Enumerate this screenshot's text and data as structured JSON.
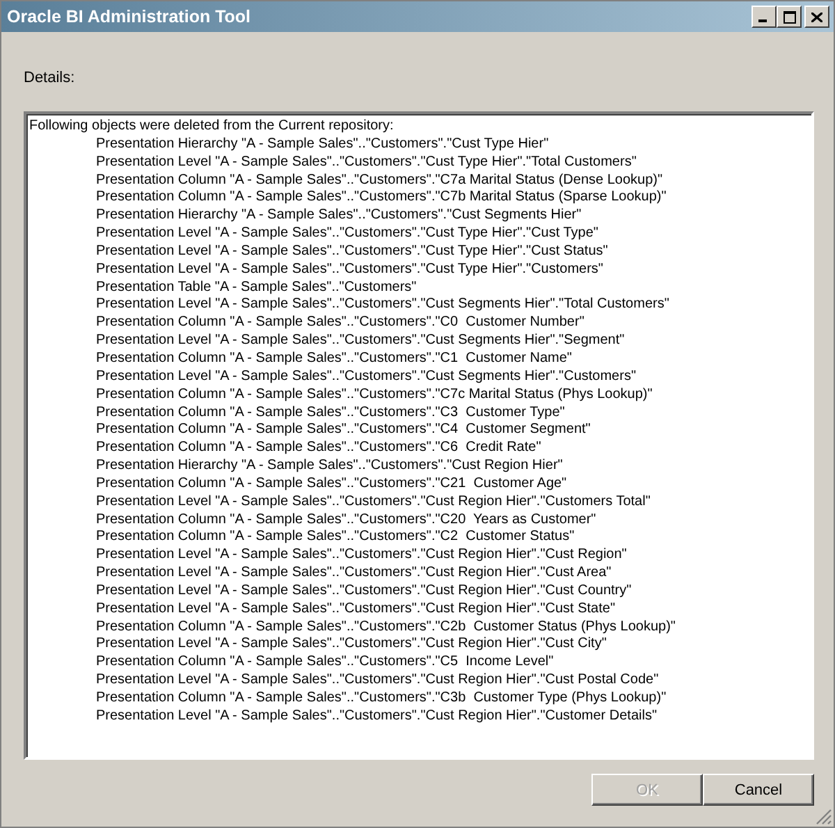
{
  "window": {
    "title": "Oracle BI Administration Tool"
  },
  "details_label": "Details:",
  "details": {
    "heading": "Following objects were deleted from the Current repository:",
    "items": [
      "Presentation Hierarchy \"A - Sample Sales\"..\"Customers\".\"Cust Type Hier\"",
      "Presentation Level \"A - Sample Sales\"..\"Customers\".\"Cust Type Hier\".\"Total Customers\"",
      "Presentation Column \"A - Sample Sales\"..\"Customers\".\"C7a Marital Status (Dense Lookup)\"",
      "Presentation Column \"A - Sample Sales\"..\"Customers\".\"C7b Marital Status (Sparse Lookup)\"",
      "Presentation Hierarchy \"A - Sample Sales\"..\"Customers\".\"Cust Segments Hier\"",
      "Presentation Level \"A - Sample Sales\"..\"Customers\".\"Cust Type Hier\".\"Cust Type\"",
      "Presentation Level \"A - Sample Sales\"..\"Customers\".\"Cust Type Hier\".\"Cust Status\"",
      "Presentation Level \"A - Sample Sales\"..\"Customers\".\"Cust Type Hier\".\"Customers\"",
      "Presentation Table \"A - Sample Sales\"..\"Customers\"",
      "Presentation Level \"A - Sample Sales\"..\"Customers\".\"Cust Segments Hier\".\"Total Customers\"",
      "Presentation Column \"A - Sample Sales\"..\"Customers\".\"C0  Customer Number\"",
      "Presentation Level \"A - Sample Sales\"..\"Customers\".\"Cust Segments Hier\".\"Segment\"",
      "Presentation Column \"A - Sample Sales\"..\"Customers\".\"C1  Customer Name\"",
      "Presentation Level \"A - Sample Sales\"..\"Customers\".\"Cust Segments Hier\".\"Customers\"",
      "Presentation Column \"A - Sample Sales\"..\"Customers\".\"C7c Marital Status (Phys Lookup)\"",
      "Presentation Column \"A - Sample Sales\"..\"Customers\".\"C3  Customer Type\"",
      "Presentation Column \"A - Sample Sales\"..\"Customers\".\"C4  Customer Segment\"",
      "Presentation Column \"A - Sample Sales\"..\"Customers\".\"C6  Credit Rate\"",
      "Presentation Hierarchy \"A - Sample Sales\"..\"Customers\".\"Cust Region Hier\"",
      "Presentation Column \"A - Sample Sales\"..\"Customers\".\"C21  Customer Age\"",
      "Presentation Level \"A - Sample Sales\"..\"Customers\".\"Cust Region Hier\".\"Customers Total\"",
      "Presentation Column \"A - Sample Sales\"..\"Customers\".\"C20  Years as Customer\"",
      "Presentation Column \"A - Sample Sales\"..\"Customers\".\"C2  Customer Status\"",
      "Presentation Level \"A - Sample Sales\"..\"Customers\".\"Cust Region Hier\".\"Cust Region\"",
      "Presentation Level \"A - Sample Sales\"..\"Customers\".\"Cust Region Hier\".\"Cust Area\"",
      "Presentation Level \"A - Sample Sales\"..\"Customers\".\"Cust Region Hier\".\"Cust Country\"",
      "Presentation Level \"A - Sample Sales\"..\"Customers\".\"Cust Region Hier\".\"Cust State\"",
      "Presentation Column \"A - Sample Sales\"..\"Customers\".\"C2b  Customer Status (Phys Lookup)\"",
      "Presentation Level \"A - Sample Sales\"..\"Customers\".\"Cust Region Hier\".\"Cust City\"",
      "Presentation Column \"A - Sample Sales\"..\"Customers\".\"C5  Income Level\"",
      "Presentation Level \"A - Sample Sales\"..\"Customers\".\"Cust Region Hier\".\"Cust Postal Code\"",
      "Presentation Column \"A - Sample Sales\"..\"Customers\".\"C3b  Customer Type (Phys Lookup)\"",
      "Presentation Level \"A - Sample Sales\"..\"Customers\".\"Cust Region Hier\".\"Customer Details\""
    ]
  },
  "buttons": [
    {
      "label": "OK",
      "disabled": true
    },
    {
      "label": "Cancel",
      "disabled": false
    }
  ]
}
